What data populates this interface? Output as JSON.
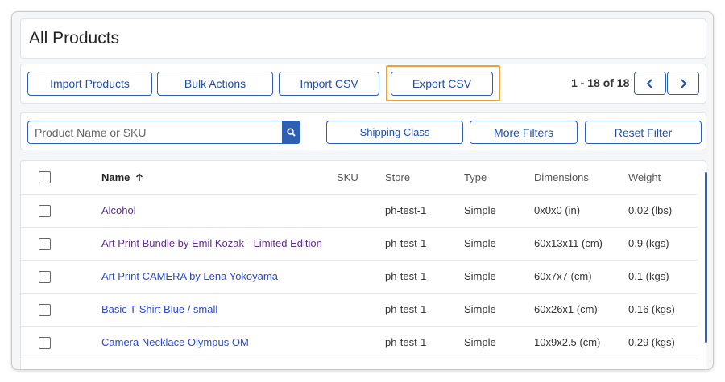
{
  "page": {
    "title": "All Products"
  },
  "toolbar": {
    "import_products": "Import Products",
    "bulk_actions": "Bulk Actions",
    "import_csv": "Import CSV",
    "export_csv": "Export CSV",
    "pagination": "1 - 18 of 18"
  },
  "filters": {
    "search_placeholder": "Product Name or SKU",
    "shipping_class": "Shipping Class",
    "more_filters": "More Filters",
    "reset_filter": "Reset Filter"
  },
  "table": {
    "columns": {
      "name": "Name",
      "sku": "SKU",
      "store": "Store",
      "type": "Type",
      "dimensions": "Dimensions",
      "weight": "Weight"
    },
    "rows": [
      {
        "name": "Alcohol",
        "sku": "",
        "store": "ph-test-1",
        "type": "Simple",
        "dimensions": "0x0x0 (in)",
        "weight": "0.02 (lbs)"
      },
      {
        "name": "Art Print Bundle by Emil Kozak - Limited Edition",
        "sku": "",
        "store": "ph-test-1",
        "type": "Simple",
        "dimensions": "60x13x11 (cm)",
        "weight": "0.9 (kgs)"
      },
      {
        "name": "Art Print CAMERA by Lena Yokoyama",
        "sku": "",
        "store": "ph-test-1",
        "type": "Simple",
        "dimensions": "60x7x7 (cm)",
        "weight": "0.1 (kgs)"
      },
      {
        "name": "Basic T-Shirt Blue / small",
        "sku": "",
        "store": "ph-test-1",
        "type": "Simple",
        "dimensions": "60x26x1 (cm)",
        "weight": "0.16 (kgs)"
      },
      {
        "name": "Camera Necklace Olympus OM",
        "sku": "",
        "store": "ph-test-1",
        "type": "Simple",
        "dimensions": "10x9x2.5 (cm)",
        "weight": "0.29 (kgs)"
      }
    ]
  },
  "colors": {
    "accent": "#2f5fb3",
    "link_visited": "#5b2d8e",
    "link": "#2848d0",
    "highlight": "#f0a030"
  },
  "icons": {
    "sort": "arrow-up-icon",
    "search": "search-icon",
    "prev": "chevron-left-icon",
    "next": "chevron-right-icon"
  }
}
